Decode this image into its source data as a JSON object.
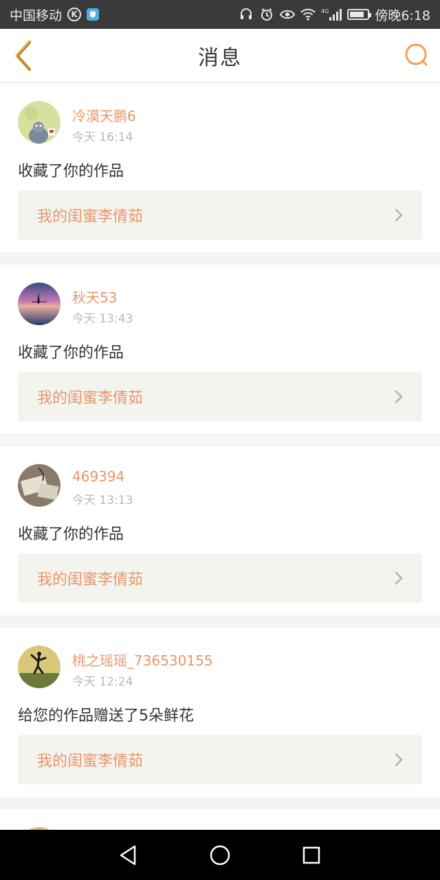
{
  "status_bar": {
    "carrier": "中国移动",
    "k_icon": "K",
    "network": "4G",
    "time": "傍晚6:18"
  },
  "header": {
    "title": "消息",
    "back_icon": "chevron-left-icon",
    "search_icon": "search-icon"
  },
  "colors": {
    "accent": "#e8956a",
    "text": "#333333",
    "muted": "#b8b8b8",
    "link_bg": "#f4f4ef"
  },
  "messages": [
    {
      "username": "冷漠天鹏6",
      "time": "今天 16:14",
      "action": "收藏了你的作品",
      "work_title": "我的闺蜜李倩茹"
    },
    {
      "username": "秋天53",
      "time": "今天 13:43",
      "action": "收藏了你的作品",
      "work_title": "我的闺蜜李倩茹"
    },
    {
      "username": "469394",
      "time": "今天 13:13",
      "action": "收藏了你的作品",
      "work_title": "我的闺蜜李倩茹"
    },
    {
      "username": "桃之瑶瑶_736530155",
      "time": "今天 12:24",
      "action": "给您的作品赠送了5朵鲜花",
      "work_title": "我的闺蜜李倩茹"
    }
  ]
}
